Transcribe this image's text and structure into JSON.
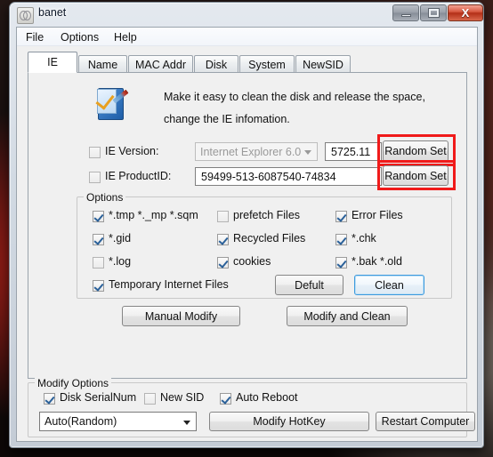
{
  "window": {
    "title": "banet",
    "icon": "app-icon",
    "buttons": {
      "minimize": "minimize-button",
      "maximize": "maximize-button",
      "close_glyph": "X"
    }
  },
  "menubar": {
    "items": [
      {
        "label": "File"
      },
      {
        "label": "Options"
      },
      {
        "label": "Help"
      }
    ]
  },
  "tabs": [
    {
      "label": "IE",
      "active": true
    },
    {
      "label": "Name",
      "active": false
    },
    {
      "label": "MAC Addr",
      "active": false
    },
    {
      "label": "Disk",
      "active": false
    },
    {
      "label": "System",
      "active": false
    },
    {
      "label": "NewSID",
      "active": false
    }
  ],
  "ie_panel": {
    "description_line1": "Make it easy to clean the disk and release the space,",
    "description_line2": "change the IE infomation.",
    "ie_version": {
      "checkbox_label": "IE Version:",
      "checked": false,
      "combo_value": "Internet Explorer 6.0",
      "build_value": "5725.11",
      "random_button": "Random Set"
    },
    "ie_productid": {
      "checkbox_label": "IE ProductID:",
      "checked": false,
      "value": "59499-513-6087540-74834",
      "random_button": "Random Set"
    },
    "options_group": {
      "title": "Options",
      "column1": [
        {
          "label": "*.tmp  *._mp  *.sqm",
          "checked": true
        },
        {
          "label": "*.gid",
          "checked": true
        },
        {
          "label": "*.log",
          "checked": false
        },
        {
          "label": "Temporary Internet Files",
          "checked": true
        }
      ],
      "column2": [
        {
          "label": "prefetch Files",
          "checked": false
        },
        {
          "label": "Recycled Files",
          "checked": true
        },
        {
          "label": "cookies",
          "checked": true
        }
      ],
      "column3": [
        {
          "label": "Error Files",
          "checked": true
        },
        {
          "label": "*.chk",
          "checked": true
        },
        {
          "label": "*.bak  *.old",
          "checked": true
        }
      ],
      "default_button": "Defult",
      "clean_button": "Clean"
    },
    "manual_modify_button": "Manual Modify",
    "modify_and_clean_button": "Modify and Clean"
  },
  "modify_options": {
    "title": "Modify Options",
    "checkboxes": [
      {
        "label": "Disk SerialNum",
        "checked": true
      },
      {
        "label": "New SID",
        "checked": false
      },
      {
        "label": "Auto Reboot",
        "checked": true
      }
    ],
    "mode_combo_value": "Auto(Random)",
    "modify_hotkey_button": "Modify HotKey",
    "restart_computer_button": "Restart Computer"
  },
  "colors": {
    "annotation_red": "#f01a1a",
    "focus_blue": "#3c9ade",
    "close_red": "#b32f18"
  }
}
